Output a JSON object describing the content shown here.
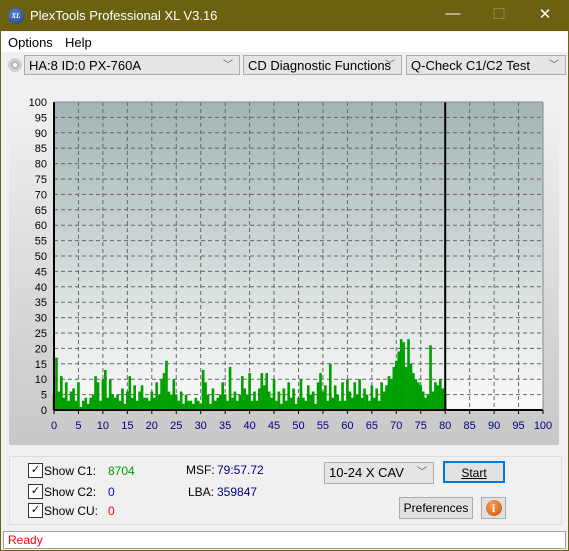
{
  "window": {
    "title": "PlexTools Professional XL V3.16",
    "logo_text": "XL",
    "min": "—",
    "max": "☐",
    "close": "✕"
  },
  "menu": {
    "items": [
      "Options",
      "Help"
    ]
  },
  "toolbar": {
    "drive": "HA:8 ID:0  PX-760A",
    "function": "CD Diagnostic Functions",
    "test": "Q-Check C1/C2 Test"
  },
  "chart_data": {
    "type": "bar",
    "xlim": [
      0,
      100
    ],
    "ylim": [
      0,
      100
    ],
    "x_ticks": [
      0,
      5,
      10,
      15,
      20,
      25,
      30,
      35,
      40,
      45,
      50,
      55,
      60,
      65,
      70,
      75,
      80,
      85,
      90,
      95,
      100
    ],
    "y_ticks": [
      0,
      5,
      10,
      15,
      20,
      25,
      30,
      35,
      40,
      45,
      50,
      55,
      60,
      65,
      70,
      75,
      80,
      85,
      90,
      95,
      100
    ],
    "grid": true,
    "end_marker_x": 80,
    "series": [
      {
        "color": "#00a000",
        "x_start": 0,
        "x_end": 80,
        "values": [
          5,
          17,
          6,
          11,
          4,
          9,
          3,
          6,
          7,
          3,
          9,
          1,
          3,
          4,
          2,
          4,
          5,
          11,
          9,
          3,
          10,
          13,
          4,
          10,
          5,
          4,
          5,
          3,
          7,
          2,
          6,
          11,
          4,
          8,
          3,
          6,
          8,
          4,
          4,
          3,
          6,
          4,
          9,
          5,
          10,
          12,
          16,
          6,
          5,
          10,
          5,
          3,
          6,
          2,
          5,
          3,
          3,
          2,
          4,
          3,
          2,
          13,
          9,
          5,
          2,
          7,
          3,
          4,
          5,
          9,
          5,
          3,
          14,
          4,
          6,
          3,
          5,
          11,
          7,
          5,
          12,
          3,
          6,
          3,
          7,
          12,
          8,
          12,
          6,
          4,
          10,
          3,
          6,
          2,
          7,
          3,
          9,
          4,
          7,
          2,
          4,
          10,
          4,
          3,
          8,
          5,
          6,
          2,
          9,
          12,
          6,
          8,
          3,
          15,
          4,
          8,
          5,
          3,
          9,
          3,
          10,
          6,
          4,
          9,
          5,
          10,
          4,
          7,
          5,
          3,
          8,
          4,
          7,
          3,
          9,
          6,
          8,
          11,
          10,
          14,
          16,
          19,
          23,
          22,
          14,
          23,
          15,
          12,
          10,
          9,
          8,
          6,
          4,
          5,
          21,
          6,
          9,
          8,
          10,
          7,
          5
        ]
      }
    ]
  },
  "stats": {
    "show_c1": "Show C1:",
    "show_c2": "Show C2:",
    "show_cu": "Show CU:",
    "c1": "8704",
    "c2": "0",
    "cu": "0",
    "msf_label": "MSF:",
    "msf": "79:57.72",
    "lba_label": "LBA:",
    "lba": "359847",
    "c1_color": "#00a000",
    "c2_color": "#0000ff",
    "cu_color": "#ff0000"
  },
  "controls": {
    "speed": "10-24 X CAV",
    "start": "Start",
    "preferences": "Preferences",
    "info": "i"
  },
  "status": {
    "text": "Ready"
  }
}
